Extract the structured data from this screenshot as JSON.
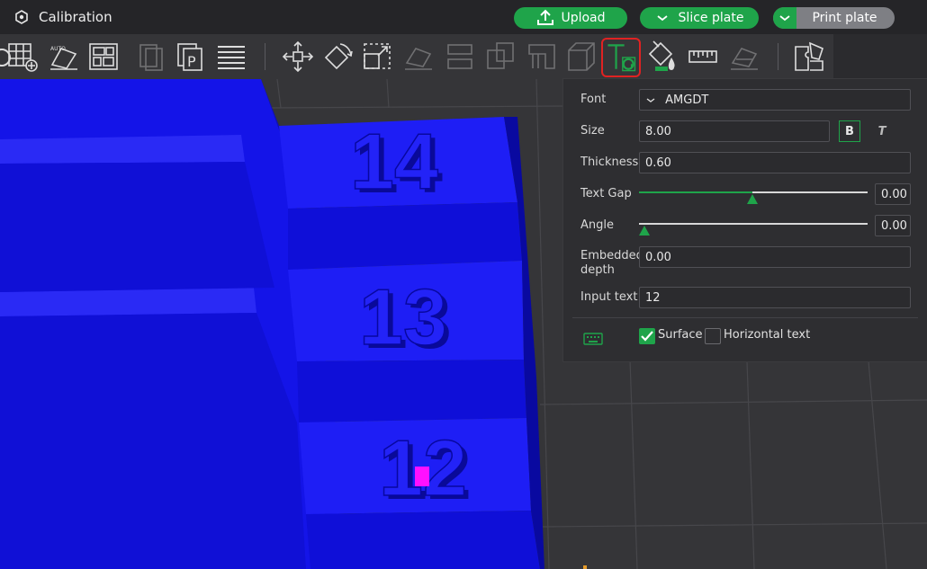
{
  "window": {
    "title": "Calibration",
    "title_icon": "settings-hex-icon"
  },
  "header_buttons": {
    "upload": {
      "label": "Upload",
      "icon": "upload-icon"
    },
    "slice": {
      "label": "Slice plate",
      "icon": "chevron-down-icon"
    },
    "print": {
      "label": "Print plate",
      "icon": "chevron-down-icon"
    }
  },
  "toolbar": {
    "items": [
      {
        "name": "add-plate"
      },
      {
        "name": "auto-orient"
      },
      {
        "name": "arrange"
      },
      {
        "name": "split-to-objects"
      },
      {
        "name": "split-to-parts"
      },
      {
        "name": "layers-variable-height"
      },
      {
        "name": "move"
      },
      {
        "name": "rotate"
      },
      {
        "name": "scale"
      },
      {
        "name": "lay-on-face"
      },
      {
        "name": "cut"
      },
      {
        "name": "mesh-boolean"
      },
      {
        "name": "support-painting"
      },
      {
        "name": "seam-painting"
      },
      {
        "name": "text-tool",
        "active": true
      },
      {
        "name": "color-painting"
      },
      {
        "name": "measure"
      },
      {
        "name": "assembly"
      },
      {
        "name": "variable-layer"
      }
    ],
    "active_highlight_color": "#e02222"
  },
  "text_panel": {
    "font": {
      "label": "Font",
      "value": "AMGDT"
    },
    "size": {
      "label": "Size",
      "value": "8.00",
      "bold_label": "B",
      "italic_label": "T",
      "bold_active": true
    },
    "thickness": {
      "label": "Thickness",
      "value": "0.60"
    },
    "text_gap": {
      "label": "Text Gap",
      "value": "0.00",
      "level": 0.5
    },
    "angle": {
      "label": "Angle",
      "value": "0.00",
      "level": 0.0
    },
    "embedded_depth": {
      "label_line1": "Embedded",
      "label_line2": "depth",
      "value": "0.00"
    },
    "input_text": {
      "label": "Input text",
      "value": "12"
    },
    "surface": {
      "label": "Surface",
      "checked": true
    },
    "horizontal_text": {
      "label": "Horizontal text",
      "checked": false
    },
    "keyboard_icon": "keyboard-icon"
  },
  "model_labels": [
    "14",
    "13",
    "12"
  ],
  "colors": {
    "accent": "#1fa44a",
    "model": "#1010e8",
    "highlight_face": "#ff10ff"
  }
}
